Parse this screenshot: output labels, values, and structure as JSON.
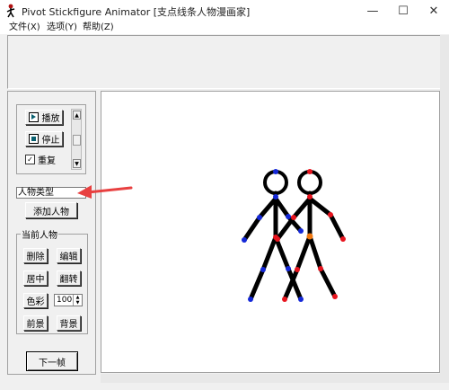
{
  "window": {
    "title": "Pivot Stickfigure Animator [支点线条人物漫画家]",
    "controls": {
      "minimize": "—",
      "maximize": "☐",
      "close": "✕"
    }
  },
  "menu": {
    "file": "文件(X)",
    "options": "选项(Y)",
    "help": "帮助(Z)"
  },
  "playback": {
    "play_label": "播放",
    "stop_label": "停止",
    "repeat_label": "重复",
    "repeat_checked": true
  },
  "figure_type": {
    "value": "人物类型",
    "add_label": "添加人物"
  },
  "current_figure": {
    "group_label": "当前人物",
    "delete_label": "删除",
    "edit_label": "编辑",
    "center_label": "居中",
    "flip_label": "翻转",
    "color_label": "色彩",
    "scale_value": "100",
    "front_label": "前景",
    "back_label": "背景"
  },
  "next_frame_label": "下一帧",
  "colors": {
    "joint_red": "#e8141e",
    "joint_blue": "#1428d8",
    "joint_orange": "#f07810",
    "annotation_arrow": "#e84040"
  }
}
